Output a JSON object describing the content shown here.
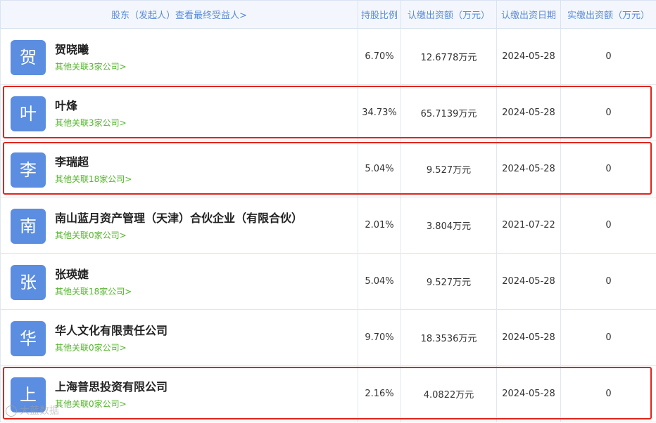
{
  "header": {
    "shareholder": "股东（发起人）查看最终受益人>",
    "ratio": "持股比例",
    "subscribed_amount": "认缴出资额（万元）",
    "subscribed_date": "认缴出资日期",
    "paid_amount": "实缴出资额（万元）"
  },
  "rows": [
    {
      "avatar": "贺",
      "name": "贺晓曦",
      "link": "其他关联3家公司>",
      "ratio": "6.70%",
      "amount": "12.6778万元",
      "date": "2024-05-28",
      "paid": "0",
      "highlighted": false
    },
    {
      "avatar": "叶",
      "name": "叶烽",
      "link": "其他关联3家公司>",
      "ratio": "34.73%",
      "amount": "65.7139万元",
      "date": "2024-05-28",
      "paid": "0",
      "highlighted": true
    },
    {
      "avatar": "李",
      "name": "李瑞超",
      "link": "其他关联18家公司>",
      "ratio": "5.04%",
      "amount": "9.527万元",
      "date": "2024-05-28",
      "paid": "0",
      "highlighted": true
    },
    {
      "avatar": "南",
      "name": "南山蓝月资产管理（天津）合伙企业（有限合伙）",
      "link": "其他关联0家公司>",
      "ratio": "2.01%",
      "amount": "3.804万元",
      "date": "2021-07-22",
      "paid": "0",
      "highlighted": false
    },
    {
      "avatar": "张",
      "name": "张瑛婕",
      "link": "其他关联18家公司>",
      "ratio": "5.04%",
      "amount": "9.527万元",
      "date": "2024-05-28",
      "paid": "0",
      "highlighted": false
    },
    {
      "avatar": "华",
      "name": "华人文化有限责任公司",
      "link": "其他关联0家公司>",
      "ratio": "9.70%",
      "amount": "18.3536万元",
      "date": "2024-05-28",
      "paid": "0",
      "highlighted": false
    },
    {
      "avatar": "上",
      "name": "上海普思投资有限公司",
      "link": "其他关联0家公司>",
      "ratio": "2.16%",
      "amount": "4.0822万元",
      "date": "2024-05-28",
      "paid": "0",
      "highlighted": true
    }
  ],
  "watermark": "大蓝数据",
  "colors": {
    "header_bg": "#f3f7fd",
    "header_text": "#5a8bd6",
    "avatar_bg": "#5b8de0",
    "link": "#55b52e",
    "highlight_border": "#e2241b"
  }
}
